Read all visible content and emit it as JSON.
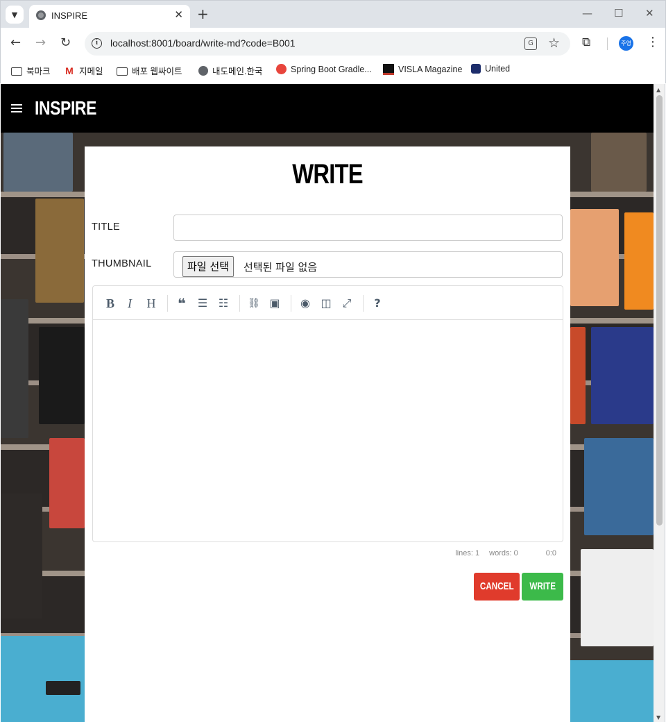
{
  "browser": {
    "tab_title": "INSPIRE",
    "url": "localhost:8001/board/write-md?code=B001",
    "profile_initials": "주영",
    "bookmarks": [
      {
        "label": "북마크",
        "icon": "folder-icon"
      },
      {
        "label": "지메일",
        "icon": "gmail-icon"
      },
      {
        "label": "배포 웹싸이트",
        "icon": "folder-icon"
      },
      {
        "label": "내도메인.한국",
        "icon": "globe-icon"
      },
      {
        "label": "Spring Boot Gradle...",
        "icon": "spring-icon"
      },
      {
        "label": "VISLA Magazine",
        "icon": "visla-icon"
      },
      {
        "label": "United",
        "icon": "united-icon"
      }
    ]
  },
  "site": {
    "brand": "INSPIRE"
  },
  "form": {
    "page_title": "WRITE",
    "title_label": "TITLE",
    "title_value": "",
    "thumbnail_label": "THUMBNAIL",
    "file_button": "파일 선택",
    "file_status": "선택된 파일 없음"
  },
  "editor": {
    "toolbar": [
      {
        "name": "bold-icon",
        "glyph": "B"
      },
      {
        "name": "italic-icon",
        "glyph": "I"
      },
      {
        "name": "heading-icon",
        "glyph": "H"
      },
      {
        "name": "quote-icon",
        "glyph": "❝"
      },
      {
        "name": "unordered-list-icon",
        "glyph": "☰"
      },
      {
        "name": "ordered-list-icon",
        "glyph": "☷"
      },
      {
        "name": "link-icon",
        "glyph": "🔗"
      },
      {
        "name": "image-icon",
        "glyph": "▣"
      },
      {
        "name": "preview-icon",
        "glyph": "◉"
      },
      {
        "name": "side-by-side-icon",
        "glyph": "◫"
      },
      {
        "name": "fullscreen-icon",
        "glyph": "⤢"
      },
      {
        "name": "help-icon",
        "glyph": "?"
      }
    ],
    "content": "",
    "status": {
      "lines": "lines: 1",
      "words": "words: 0",
      "cursor": "0:0"
    }
  },
  "actions": {
    "cancel_label": "CANCEL",
    "write_label": "WRITE",
    "cancel_color": "#e03b2c",
    "write_color": "#3cba4a"
  }
}
